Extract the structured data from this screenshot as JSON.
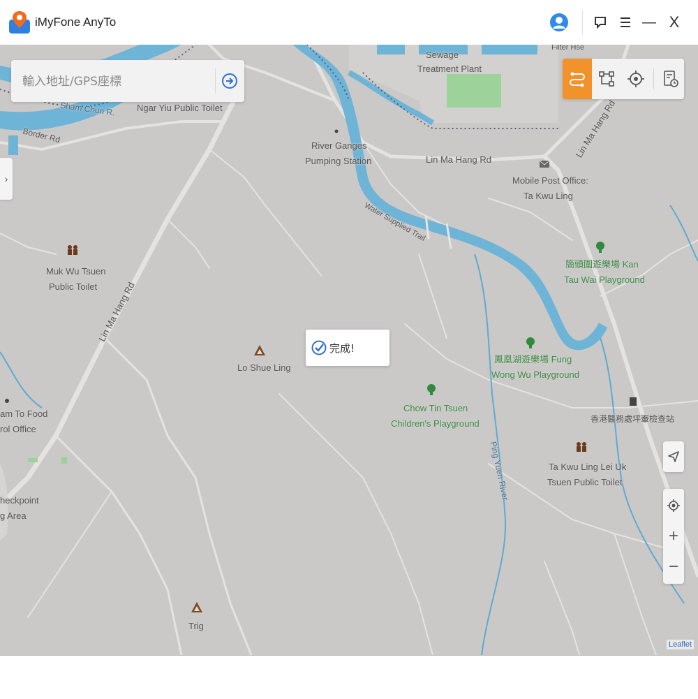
{
  "app": {
    "title": "iMyFone AnyTo"
  },
  "titlebar": {
    "icons": [
      "avatar-icon",
      "feedback-icon",
      "menu-icon",
      "minimize-icon",
      "close-icon"
    ],
    "minimize": "—",
    "close": "X"
  },
  "search": {
    "placeholder": "輸入地址/GPS座標",
    "value": ""
  },
  "side_toggle": {
    "glyph": "›"
  },
  "modes": {
    "items": [
      "multi-spot-route-icon",
      "jump-teleport-icon",
      "teleport-target-icon",
      "history-icon"
    ],
    "active": "multi-spot-route-icon",
    "active_color": "#f2922b"
  },
  "toast": {
    "text": "完成!",
    "icon": "check-circle-icon"
  },
  "map": {
    "labels": {
      "sewage": "Sewage",
      "treatment": "Treatment Plant",
      "filter_house": "Filter Hse",
      "sham_chun": "Sham Chun R.",
      "border_rd": "Border Rd",
      "ngar_yiu": "Ngar Yiu Public Toilet",
      "river_ganges": "River Ganges",
      "pumping": "Pumping Station",
      "lin_ma_hang_rd_1": "Lin Ma Hang Rd",
      "lin_ma_hang_rd_2": "Lin Ma Hang Rd",
      "lin_ma_hang_rd_3": "Lin Ma Hang Rd",
      "post_office_1": "Mobile Post Office:",
      "post_office_2": "Ta Kwu Ling",
      "water_trail": "Water Supplied Trail",
      "muk_wu_1": "Muk Wu Tsuen",
      "muk_wu_2": "Public Toilet",
      "kan_tau_1": "簡頭圍遊樂場 Kan",
      "kan_tau_2": "Tau Wai Playground",
      "lo_shue_ling": "Lo Shue Ling",
      "fung_wong_1": "鳳凰湖遊樂場 Fung",
      "fung_wong_2": "Wong Wu Playground",
      "chow_tin_1": "Chow Tin Tsuen",
      "chow_tin_2": "Children's Playground",
      "food_office_1": "am To Food",
      "food_office_2": "rol Office",
      "inspection": "香港醫務處坪輋檢查站",
      "ping_yuen": "Ping Yuen River",
      "ta_kwu_ling_1": "Ta Kwu Ling Lei Uk",
      "ta_kwu_ling_2": "Tsuen Public Toilet",
      "checkpoint_1": "heckpoint",
      "checkpoint_2": "g Area",
      "trig": "Trig"
    },
    "colors": {
      "land": "#c9c8c6",
      "water": "#6eb4d6",
      "road": "#e6e5e3",
      "green": "#3d8a45",
      "park": "#9dd39a"
    }
  },
  "controls": {
    "zoom_in": "+",
    "zoom_out": "−",
    "icons": [
      "navigate-arrow-icon",
      "locate-icon"
    ]
  },
  "attribution": "Leaflet"
}
